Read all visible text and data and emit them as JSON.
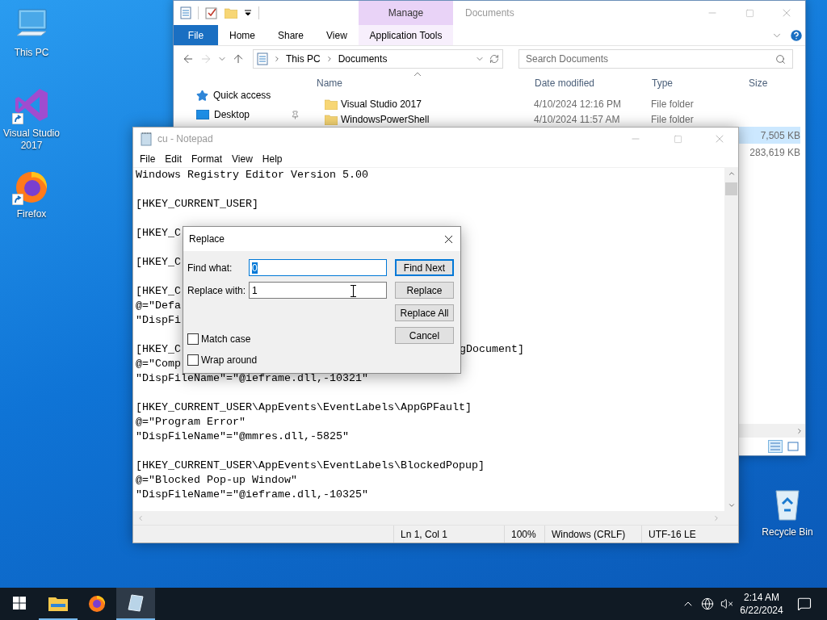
{
  "desktop_left": [
    {
      "kind": "computer",
      "label": "This PC",
      "shortcut": false
    },
    {
      "kind": "visual-studio",
      "label": "Visual Studio 2017",
      "shortcut": true
    },
    {
      "kind": "firefox",
      "label": "Firefox",
      "shortcut": true
    }
  ],
  "desktop_right": [
    {
      "kind": "recycle-bin",
      "label": "Recycle Bin",
      "shortcut": false
    }
  ],
  "explorer": {
    "title": "Documents",
    "context_tab": "Manage",
    "ribbon_tabs": [
      {
        "label": "File",
        "kind": "file"
      },
      {
        "label": "Home",
        "kind": "tab"
      },
      {
        "label": "Share",
        "kind": "tab"
      },
      {
        "label": "View",
        "kind": "tab"
      },
      {
        "label": "Application Tools",
        "kind": "context"
      }
    ],
    "address": [
      "This PC",
      "Documents"
    ],
    "search": {
      "placeholder": "Search Documents"
    },
    "nav": [
      {
        "label": "Quick access",
        "kind": "quick-access",
        "pinned": false
      },
      {
        "label": "Desktop",
        "kind": "desktop",
        "pinned": true
      }
    ],
    "columns": [
      "Name",
      "Date modified",
      "Type",
      "Size"
    ],
    "rows": [
      {
        "name": "Visual Studio 2017",
        "date": "4/10/2024 12:16 PM",
        "type": "File folder",
        "selected": false
      },
      {
        "name": "WindowsPowerShell",
        "date": "4/10/2024 11:57 AM",
        "type": "File folder",
        "selected": false
      },
      {
        "size": "7,505 KB",
        "selected": true
      },
      {
        "size": "283,619 KB",
        "selected": false
      }
    ]
  },
  "notepad": {
    "title": "cu - Notepad",
    "active": false,
    "menu": [
      "File",
      "Edit",
      "Format",
      "View",
      "Help"
    ],
    "blocks": [
      [
        {
          "text": "Windows Registry Editor Version 5.00"
        }
      ],
      [
        {
          "text": "[HKEY_CURRENT_USER]"
        }
      ],
      [
        {
          "text": "[HKEY_C"
        }
      ],
      [
        {
          "text": "[HKEY_C"
        }
      ],
      [
        {
          "text": "[HKEY_C"
        },
        {
          "text": "@=\"Defa"
        },
        {
          "text": "\"DispFi"
        }
      ],
      [
        {
          "text": "[HKEY_C",
          "tail": "gDocument]"
        },
        {
          "text": "@=\"Comp"
        },
        {
          "text": "\"DispFileName\"=\"@ieframe.dll,-10321\""
        }
      ],
      [
        {
          "text": "[HKEY_CURRENT_USER\\AppEvents\\EventLabels\\AppGPFault]"
        },
        {
          "text": "@=\"Program Error\""
        },
        {
          "text": "\"DispFileName\"=\"@mmres.dll,-5825\""
        }
      ],
      [
        {
          "text": "[HKEY_CURRENT_USER\\AppEvents\\EventLabels\\BlockedPopup]"
        },
        {
          "text": "@=\"Blocked Pop-up Window\""
        },
        {
          "text": "\"DispFileName\"=\"@ieframe.dll,-10325\""
        }
      ]
    ],
    "status": [
      "Ln 1, Col 1",
      "100%",
      "Windows (CRLF)",
      "UTF-16 LE"
    ]
  },
  "replace": {
    "title": "Replace",
    "find": {
      "label": "Find what:",
      "value": "0",
      "selected": true
    },
    "replace": {
      "label": "Replace with:",
      "value": "1"
    },
    "buttons": [
      {
        "label": "Find Next",
        "default": true
      },
      {
        "label": "Replace",
        "default": false
      },
      {
        "label": "Replace All",
        "default": false
      },
      {
        "label": "Cancel",
        "default": false
      }
    ],
    "options": [
      {
        "label": "Match case",
        "checked": false
      },
      {
        "label": "Wrap around",
        "checked": false
      }
    ]
  },
  "taskbar": {
    "apps": [
      {
        "kind": "explorer",
        "running": true,
        "active": false
      },
      {
        "kind": "firefox",
        "running": false,
        "active": false
      },
      {
        "kind": "notepad",
        "running": true,
        "active": true
      }
    ],
    "time": "2:14 AM",
    "date": "6/22/2024"
  }
}
